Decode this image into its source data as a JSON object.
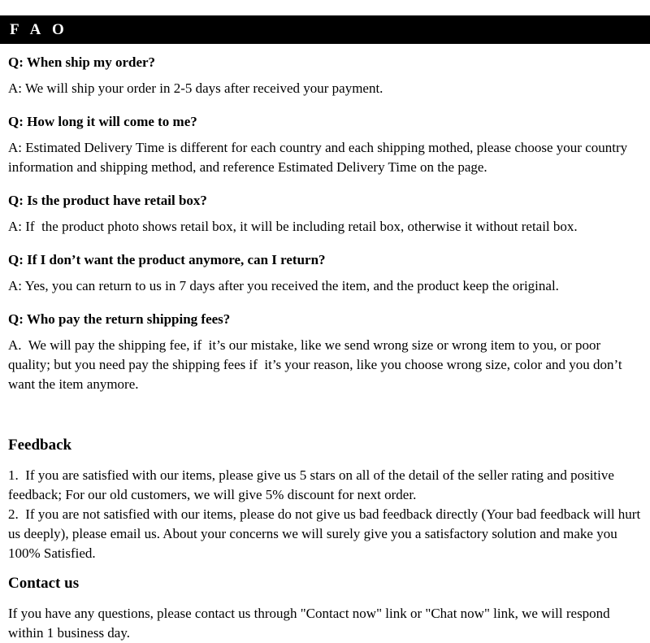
{
  "header": {
    "title": "F A O",
    "background_color": "#000000",
    "text_color": "#ffffff"
  },
  "faq": {
    "items": [
      {
        "question": "Q: When ship my order?",
        "answer": "A: We will ship your order in 2-5 days after received your payment."
      },
      {
        "question": "Q: How long it will come to me?",
        "answer": "A: Estimated Delivery Time is different for each country and each shipping mothed, please choose your country information and shipping method, and reference Estimated Delivery Time on the page."
      },
      {
        "question": "Q: Is the product have retail box?",
        "answer": "A: If  the product photo shows retail box, it will be including retail box, otherwise it without retail box."
      },
      {
        "question": "Q: If I don’t want the product anymore, can I return?",
        "answer": "A: Yes, you can return to us in 7 days after you received the item, and the product keep the original."
      },
      {
        "question": "Q: Who pay the return shipping fees?",
        "answer": "A.  We will pay the shipping fee, if  it’s our mistake, like we send wrong size or wrong item to you, or poor quality; but you need pay the shipping fees if  it’s your reason, like you choose wrong size, color and you don’t want the item anymore."
      }
    ]
  },
  "feedback": {
    "heading": "Feedback",
    "item_1": "1.  If you are satisfied with our items, please give us 5 stars on all of the detail of the seller rating and positive feedback; For our old customers, we will give 5% discount for next order.",
    "item_2": "2.  If you are not satisfied with our items, please do not give us bad feedback directly (Your bad feedback will hurt us deeply), please email us. About your concerns we will surely give you a satisfactory solution and make you 100% Satisfied."
  },
  "contact": {
    "heading": "Contact us",
    "body": "If you have any questions, please contact us through \"Contact now\" link or \"Chat now\" link, we will respond within 1 business day."
  },
  "colors": {
    "background": "#ffffff",
    "text": "#000000",
    "bar": "#000000"
  }
}
